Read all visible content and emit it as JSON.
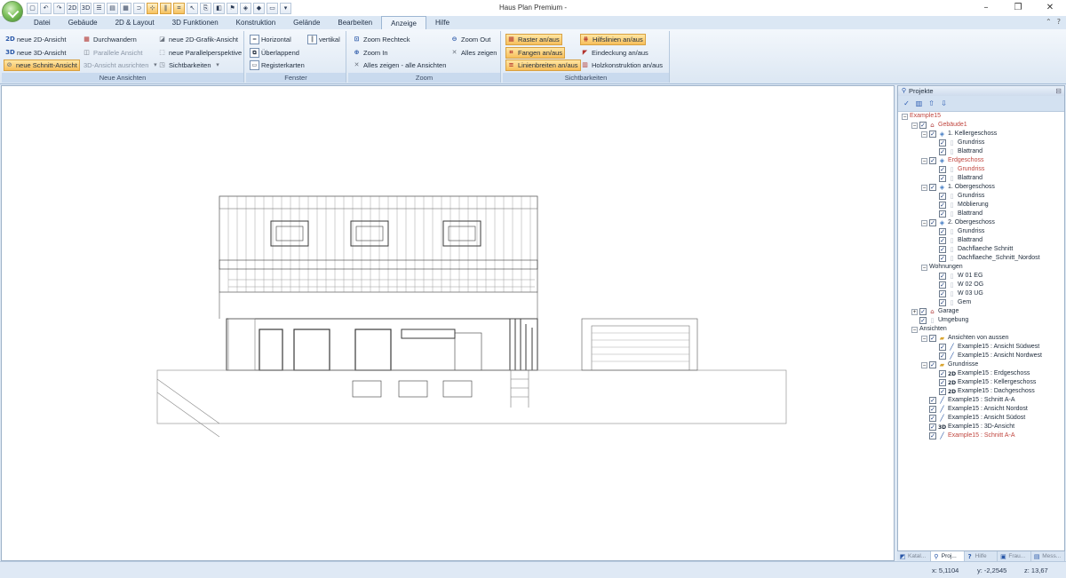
{
  "window": {
    "title": "Haus Plan Premium -",
    "minimize_glyph": "–",
    "maximize_glyph": "❐",
    "close_glyph": "✕"
  },
  "quick_access": [
    {
      "name": "new-doc-icon",
      "glyph": "▢"
    },
    {
      "name": "undo-icon",
      "glyph": "↶"
    },
    {
      "name": "redo-icon",
      "glyph": "↷"
    },
    {
      "name": "2d-view-icon",
      "glyph": "2D"
    },
    {
      "name": "3d-view-icon",
      "glyph": "3D"
    },
    {
      "name": "wall-icon",
      "glyph": "☰"
    },
    {
      "name": "floor-icon",
      "glyph": "▤"
    },
    {
      "name": "roof-icon",
      "glyph": "▦"
    },
    {
      "name": "magnet-icon",
      "glyph": "⊃"
    },
    {
      "name": "snap-icon",
      "glyph": "⊹"
    },
    {
      "name": "parallel-icon",
      "glyph": "∥"
    },
    {
      "name": "measure-icon",
      "glyph": "⌗"
    },
    {
      "name": "pointer-icon",
      "glyph": "↖"
    },
    {
      "name": "copy-icon",
      "glyph": "⎘"
    },
    {
      "name": "color-icon",
      "glyph": "◧"
    },
    {
      "name": "flag-icon",
      "glyph": "⚑"
    },
    {
      "name": "paint-icon",
      "glyph": "◈"
    },
    {
      "name": "eraser-icon",
      "glyph": "◆"
    },
    {
      "name": "page-icon",
      "glyph": "▭"
    },
    {
      "name": "customize-icon",
      "glyph": "▾"
    }
  ],
  "tabs": [
    "Datei",
    "Gebäude",
    "2D & Layout",
    "3D Funktionen",
    "Konstruktion",
    "Gelände",
    "Bearbeiten",
    "Anzeige",
    "Hilfe"
  ],
  "active_tab": "Anzeige",
  "ribbon_controls": {
    "collapse": "⌃",
    "help": "?"
  },
  "ribbon": {
    "neue_ansichten": {
      "label": "Neue Ansichten",
      "btn_2d": "neue 2D-Ansicht",
      "btn_3d": "neue 3D-Ansicht",
      "btn_schnitt": "neue Schnitt-Ansicht",
      "btn_durchwandern": "Durchwandern",
      "btn_parallel": "Parallele Ansicht",
      "btn_3d_ausrichten": "3D-Ansicht ausrichten",
      "btn_2d_grafik": "neue 2D-Grafik-Ansicht",
      "btn_parallelperspektive": "neue Parallelperspektive",
      "btn_sichtbarkeiten": "Sichtbarkeiten"
    },
    "fenster": {
      "label": "Fenster",
      "btn_horizontal": "Horizontal",
      "btn_vertikal": "vertikal",
      "btn_ueberlappend": "Überlappend",
      "btn_registerkarten": "Registerkarten"
    },
    "zoom": {
      "label": "Zoom",
      "btn_rechteck": "Zoom Rechteck",
      "btn_out": "Zoom Out",
      "btn_in": "Zoom In",
      "btn_alles": "Alles zeigen",
      "btn_alles_alle": "Alles zeigen - alle Ansichten"
    },
    "sichtbarkeiten": {
      "label": "Sichtbarkeiten",
      "btn_raster": "Raster an/aus",
      "btn_hilfslinien": "Hilfslinien an/aus",
      "btn_fangen": "Fangen an/aus",
      "btn_eindeckung": "Eindeckung an/aus",
      "btn_linienbreiten": "Linienbreiten an/aus",
      "btn_holzkonstruktion": "Holzkonstruktion an/aus"
    }
  },
  "panel": {
    "title": "Projekte",
    "pin_glyph": "⊟"
  },
  "tree": [
    {
      "label": "Example15",
      "depth": 0,
      "toggle": "−",
      "check": false,
      "icon": "",
      "red": true
    },
    {
      "label": "Gebäude1",
      "depth": 1,
      "toggle": "−",
      "check": true,
      "icon": "house",
      "red": true
    },
    {
      "label": "1. Kellergeschoss",
      "depth": 2,
      "toggle": "−",
      "check": true,
      "icon": "floor",
      "red": false
    },
    {
      "label": "Grundriss",
      "depth": 3,
      "toggle": "",
      "check": true,
      "icon": "doc",
      "red": false
    },
    {
      "label": "Blattrand",
      "depth": 3,
      "toggle": "",
      "check": true,
      "icon": "doc",
      "red": false
    },
    {
      "label": "Erdgeschoss",
      "depth": 2,
      "toggle": "−",
      "check": true,
      "icon": "floor",
      "red": true
    },
    {
      "label": "Grundriss",
      "depth": 3,
      "toggle": "",
      "check": true,
      "icon": "doc",
      "red": true
    },
    {
      "label": "Blattrand",
      "depth": 3,
      "toggle": "",
      "check": true,
      "icon": "doc",
      "red": false
    },
    {
      "label": "1. Obergeschoss",
      "depth": 2,
      "toggle": "−",
      "check": true,
      "icon": "floor",
      "red": false
    },
    {
      "label": "Grundriss",
      "depth": 3,
      "toggle": "",
      "check": true,
      "icon": "doc",
      "red": false
    },
    {
      "label": "Möblierung",
      "depth": 3,
      "toggle": "",
      "check": true,
      "icon": "doc",
      "red": false
    },
    {
      "label": "Blattrand",
      "depth": 3,
      "toggle": "",
      "check": true,
      "icon": "doc",
      "red": false
    },
    {
      "label": "2. Obergeschoss",
      "depth": 2,
      "toggle": "−",
      "check": true,
      "icon": "floor",
      "red": false
    },
    {
      "label": "Grundriss",
      "depth": 3,
      "toggle": "",
      "check": true,
      "icon": "doc",
      "red": false
    },
    {
      "label": "Blattrand",
      "depth": 3,
      "toggle": "",
      "check": true,
      "icon": "doc",
      "red": false
    },
    {
      "label": "Dachflaeche Schnitt",
      "depth": 3,
      "toggle": "",
      "check": true,
      "icon": "doc",
      "red": false
    },
    {
      "label": "Dachflaeche_Schnitt_Nordost",
      "depth": 3,
      "toggle": "",
      "check": true,
      "icon": "doc",
      "red": false
    },
    {
      "label": "Wohnungen",
      "depth": 2,
      "toggle": "−",
      "check": false,
      "icon": "",
      "red": false
    },
    {
      "label": "W 01 EG",
      "depth": 3,
      "toggle": "",
      "check": true,
      "icon": "doc",
      "red": false
    },
    {
      "label": "W 02 OG",
      "depth": 3,
      "toggle": "",
      "check": true,
      "icon": "doc",
      "red": false
    },
    {
      "label": "W 03 UG",
      "depth": 3,
      "toggle": "",
      "check": true,
      "icon": "doc",
      "red": false
    },
    {
      "label": "Gem",
      "depth": 3,
      "toggle": "",
      "check": true,
      "icon": "doc",
      "red": false
    },
    {
      "label": "Garage",
      "depth": 1,
      "toggle": "+",
      "check": true,
      "icon": "house",
      "red": false
    },
    {
      "label": "Umgebung",
      "depth": 1,
      "toggle": "",
      "check": true,
      "icon": "doc",
      "red": false
    },
    {
      "label": "Ansichten",
      "depth": 1,
      "toggle": "−",
      "check": false,
      "icon": "",
      "red": false
    },
    {
      "label": "Ansichten von aussen",
      "depth": 2,
      "toggle": "−",
      "check": true,
      "icon": "folder",
      "red": false
    },
    {
      "label": "Example15 : Ansicht Südwest",
      "depth": 3,
      "toggle": "",
      "check": true,
      "icon": "view",
      "red": false
    },
    {
      "label": "Example15 : Ansicht Nordwest",
      "depth": 3,
      "toggle": "",
      "check": true,
      "icon": "view",
      "red": false
    },
    {
      "label": "Grundrisse",
      "depth": 2,
      "toggle": "−",
      "check": true,
      "icon": "folder",
      "red": false
    },
    {
      "label": "Example15 : Erdgeschoss",
      "depth": 3,
      "toggle": "",
      "check": true,
      "icon": "2D",
      "red": false
    },
    {
      "label": "Example15 : Kellergeschoss",
      "depth": 3,
      "toggle": "",
      "check": true,
      "icon": "2D",
      "red": false
    },
    {
      "label": "Example15 : Dachgeschoss",
      "depth": 3,
      "toggle": "",
      "check": true,
      "icon": "2D",
      "red": false
    },
    {
      "label": "Example15 : Schnitt A-A",
      "depth": 2,
      "toggle": "",
      "check": true,
      "icon": "view",
      "red": false
    },
    {
      "label": "Example15 : Ansicht Nordost",
      "depth": 2,
      "toggle": "",
      "check": true,
      "icon": "view",
      "red": false
    },
    {
      "label": "Example15 : Ansicht Südost",
      "depth": 2,
      "toggle": "",
      "check": true,
      "icon": "view",
      "red": false
    },
    {
      "label": "Example15 : 3D-Ansicht",
      "depth": 2,
      "toggle": "",
      "check": true,
      "icon": "3D",
      "red": false
    },
    {
      "label": "Example15 : Schnitt A-A",
      "depth": 2,
      "toggle": "",
      "check": true,
      "icon": "view",
      "red": true
    }
  ],
  "panel_tabs": [
    {
      "label": "Katal...",
      "glyph": "◩",
      "active": false
    },
    {
      "label": "Proj...",
      "glyph": "⚲",
      "active": true
    },
    {
      "label": "Hilfe",
      "glyph": "?",
      "active": false
    },
    {
      "label": "Frau...",
      "glyph": "▣",
      "active": false
    },
    {
      "label": "Mess...",
      "glyph": "▤",
      "active": false
    }
  ],
  "status": {
    "x": "x: 5,1104",
    "y": "y: -2,2545",
    "z": "z: 13,67"
  }
}
